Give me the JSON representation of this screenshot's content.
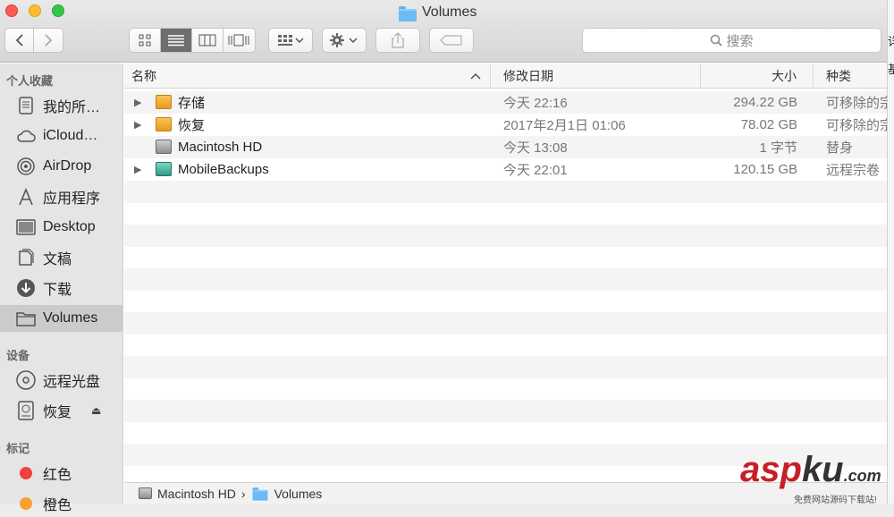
{
  "window": {
    "title": "Volumes"
  },
  "toolbar": {
    "back_icon": "chevron-left-icon",
    "forward_icon": "chevron-right-icon",
    "search_placeholder": "搜索"
  },
  "sidebar": {
    "favorites_heading": "个人收藏",
    "favorites": [
      {
        "label": "我的所…",
        "icon": "all-files-icon"
      },
      {
        "label": "iCloud…",
        "icon": "cloud-icon"
      },
      {
        "label": "AirDrop",
        "icon": "airdrop-icon"
      },
      {
        "label": "应用程序",
        "icon": "applications-icon"
      },
      {
        "label": "Desktop",
        "icon": "desktop-icon"
      },
      {
        "label": "文稿",
        "icon": "documents-icon"
      },
      {
        "label": "下载",
        "icon": "downloads-icon"
      },
      {
        "label": "Volumes",
        "icon": "folder-icon",
        "selected": true
      }
    ],
    "devices_heading": "设备",
    "devices": [
      {
        "label": "远程光盘",
        "icon": "disc-icon"
      },
      {
        "label": "恢复",
        "icon": "drive-icon",
        "eject": "⏏"
      }
    ],
    "tags_heading": "标记",
    "tags": [
      {
        "label": "红色",
        "color": "#f23f3f"
      },
      {
        "label": "橙色",
        "color": "#f7a22f"
      }
    ]
  },
  "list": {
    "columns": {
      "name": "名称",
      "date": "修改日期",
      "size": "大小",
      "kind": "种类"
    },
    "rows": [
      {
        "name": "存储",
        "date": "今天 22:16",
        "size": "294.22 GB",
        "kind": "可移除的宗",
        "expandable": true,
        "icon": "orange-drive-icon"
      },
      {
        "name": "恢复",
        "date": "2017年2月1日 01:06",
        "size": "78.02 GB",
        "kind": "可移除的宗",
        "expandable": true,
        "icon": "orange-drive-icon"
      },
      {
        "name": "Macintosh HD",
        "date": "今天 13:08",
        "size": "1 字节",
        "kind": "替身",
        "expandable": false,
        "icon": "hard-drive-icon"
      },
      {
        "name": "MobileBackups",
        "date": "今天 22:01",
        "size": "120.15 GB",
        "kind": "远程宗卷",
        "expandable": true,
        "icon": "time-machine-icon"
      }
    ]
  },
  "pathbar": {
    "disk": "Macintosh HD",
    "separator": "›",
    "folder": "Volumes"
  },
  "watermark": {
    "main_red": "asp",
    "main_dark": "ku",
    "suffix": ".com",
    "sub": "免费网站源码下载站!"
  },
  "edge_glyphs": [
    "详",
    "基"
  ]
}
